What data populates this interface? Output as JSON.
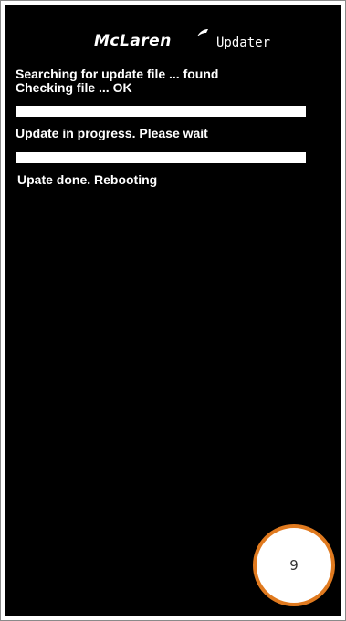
{
  "header": {
    "brand": "McLaren",
    "title": "Updater"
  },
  "log": {
    "line1": "Searching for update file ... found",
    "line2": "Checking file ... OK",
    "line3": "Update in progress. Please wait",
    "line4": "Upate done. Rebooting"
  },
  "progress": {
    "check_fraction": 1.0,
    "update_fraction": 1.0
  },
  "step_badge": "9",
  "colors": {
    "screen_bg": "#000000",
    "text": "#ffffff",
    "badge_ring": "#e07a1f"
  }
}
